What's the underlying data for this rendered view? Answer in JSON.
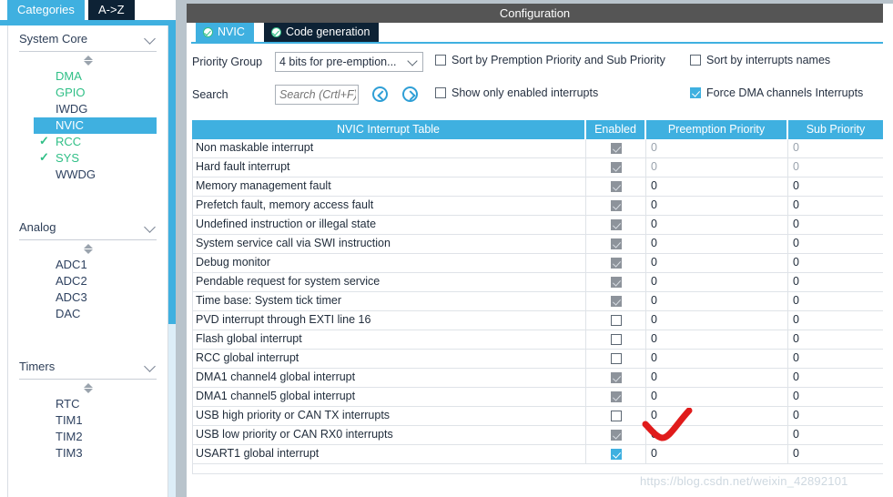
{
  "sidebar": {
    "tabs": [
      {
        "label": "Categories",
        "active": true
      },
      {
        "label": "A->Z",
        "active": false
      }
    ],
    "groups": [
      {
        "title": "System Core",
        "items": [
          {
            "label": "DMA",
            "state": "configured"
          },
          {
            "label": "GPIO",
            "state": "configured"
          },
          {
            "label": "IWDG",
            "state": "none"
          },
          {
            "label": "NVIC",
            "state": "selected"
          },
          {
            "label": "RCC",
            "state": "checked"
          },
          {
            "label": "SYS",
            "state": "checked"
          },
          {
            "label": "WWDG",
            "state": "none"
          }
        ]
      },
      {
        "title": "Analog",
        "items": [
          {
            "label": "ADC1",
            "state": "none"
          },
          {
            "label": "ADC2",
            "state": "none"
          },
          {
            "label": "ADC3",
            "state": "none"
          },
          {
            "label": "DAC",
            "state": "none"
          }
        ]
      },
      {
        "title": "Timers",
        "items": [
          {
            "label": "RTC",
            "state": "none"
          },
          {
            "label": "TIM1",
            "state": "none"
          },
          {
            "label": "TIM2",
            "state": "none"
          },
          {
            "label": "TIM3",
            "state": "none"
          }
        ]
      }
    ]
  },
  "config": {
    "title": "Configuration",
    "tabs": [
      {
        "label": "NVIC",
        "active": true
      },
      {
        "label": "Code generation",
        "active": false
      }
    ],
    "priority_group_label": "Priority Group",
    "priority_group_value": "4 bits for pre-emption...",
    "search_label": "Search",
    "search_placeholder": "Search (Crtl+F)",
    "search_value": "",
    "prev_button": "previous-match",
    "next_button": "next-match",
    "checkboxes": [
      {
        "label": "Sort by Premption Priority and Sub Priority",
        "checked": false
      },
      {
        "label": "Sort by interrupts names",
        "checked": false
      },
      {
        "label": "Show only enabled interrupts",
        "checked": false
      },
      {
        "label": "Force DMA channels Interrupts",
        "checked": true
      }
    ]
  },
  "table": {
    "headers": [
      "NVIC Interrupt Table",
      "Enabled",
      "Preemption Priority",
      "Sub Priority"
    ],
    "rows": [
      {
        "name": "Non maskable interrupt",
        "enabled": "disabled-checked",
        "pp": "0",
        "sp": "0",
        "grey": true
      },
      {
        "name": "Hard fault interrupt",
        "enabled": "disabled-checked",
        "pp": "0",
        "sp": "0",
        "grey": true
      },
      {
        "name": "Memory management fault",
        "enabled": "disabled-checked",
        "pp": "0",
        "sp": "0",
        "grey": false
      },
      {
        "name": "Prefetch fault, memory access fault",
        "enabled": "disabled-checked",
        "pp": "0",
        "sp": "0",
        "grey": false
      },
      {
        "name": "Undefined instruction or illegal state",
        "enabled": "disabled-checked",
        "pp": "0",
        "sp": "0",
        "grey": false
      },
      {
        "name": "System service call via SWI instruction",
        "enabled": "disabled-checked",
        "pp": "0",
        "sp": "0",
        "grey": false
      },
      {
        "name": "Debug monitor",
        "enabled": "disabled-checked",
        "pp": "0",
        "sp": "0",
        "grey": false
      },
      {
        "name": "Pendable request for system service",
        "enabled": "disabled-checked",
        "pp": "0",
        "sp": "0",
        "grey": false
      },
      {
        "name": "Time base: System tick timer",
        "enabled": "disabled-checked",
        "pp": "0",
        "sp": "0",
        "grey": false
      },
      {
        "name": "PVD interrupt through EXTI line 16",
        "enabled": "unchecked",
        "pp": "0",
        "sp": "0",
        "grey": false
      },
      {
        "name": "Flash global interrupt",
        "enabled": "unchecked",
        "pp": "0",
        "sp": "0",
        "grey": false
      },
      {
        "name": "RCC global interrupt",
        "enabled": "unchecked",
        "pp": "0",
        "sp": "0",
        "grey": false
      },
      {
        "name": "DMA1 channel4 global interrupt",
        "enabled": "disabled-checked",
        "pp": "0",
        "sp": "0",
        "grey": false
      },
      {
        "name": "DMA1 channel5 global interrupt",
        "enabled": "disabled-checked",
        "pp": "0",
        "sp": "0",
        "grey": false
      },
      {
        "name": "USB high priority or CAN TX interrupts",
        "enabled": "unchecked",
        "pp": "0",
        "sp": "0",
        "grey": false
      },
      {
        "name": "USB low priority or CAN RX0 interrupts",
        "enabled": "disabled-checked",
        "pp": "0",
        "sp": "0",
        "grey": false
      },
      {
        "name": "USART1 global interrupt",
        "enabled": "checked",
        "pp": "0",
        "sp": "0",
        "grey": false
      }
    ]
  },
  "annotation": {
    "type": "red-check-mark",
    "color": "#e01b1b"
  },
  "watermark": "https://blog.csdn.net/weixin_42892101",
  "colors": {
    "accent": "#3fb0e0",
    "tab_dark": "#0d2235",
    "title_bar": "#555555",
    "green": "#2fbf86",
    "gutter": "#b9c4cc"
  }
}
